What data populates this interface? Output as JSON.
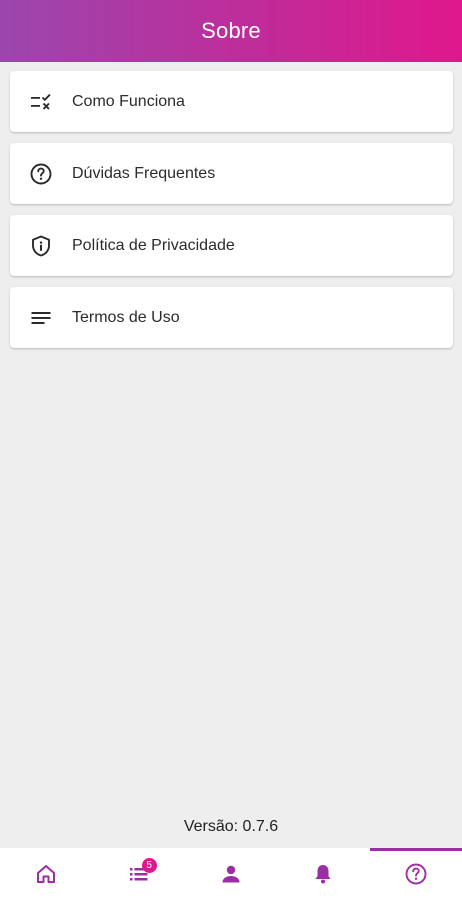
{
  "header": {
    "title": "Sobre"
  },
  "menu": {
    "items": [
      {
        "label": "Como Funciona",
        "icon": "rule-icon"
      },
      {
        "label": "Dúvidas Frequentes",
        "icon": "help-circle-icon"
      },
      {
        "label": "Política de Privacidade",
        "icon": "shield-info-icon"
      },
      {
        "label": "Termos de Uso",
        "icon": "notes-lines-icon"
      }
    ]
  },
  "footer": {
    "version": "Versão: 0.7.6"
  },
  "bottom_nav": {
    "accent_color": "#9c2ea3",
    "badge_color": "#e0178c",
    "items": [
      {
        "icon": "home-icon",
        "active": false
      },
      {
        "icon": "list-icon",
        "active": false,
        "badge": "5"
      },
      {
        "icon": "person-icon",
        "active": false
      },
      {
        "icon": "bell-icon",
        "active": false
      },
      {
        "icon": "help-icon",
        "active": true
      }
    ]
  }
}
